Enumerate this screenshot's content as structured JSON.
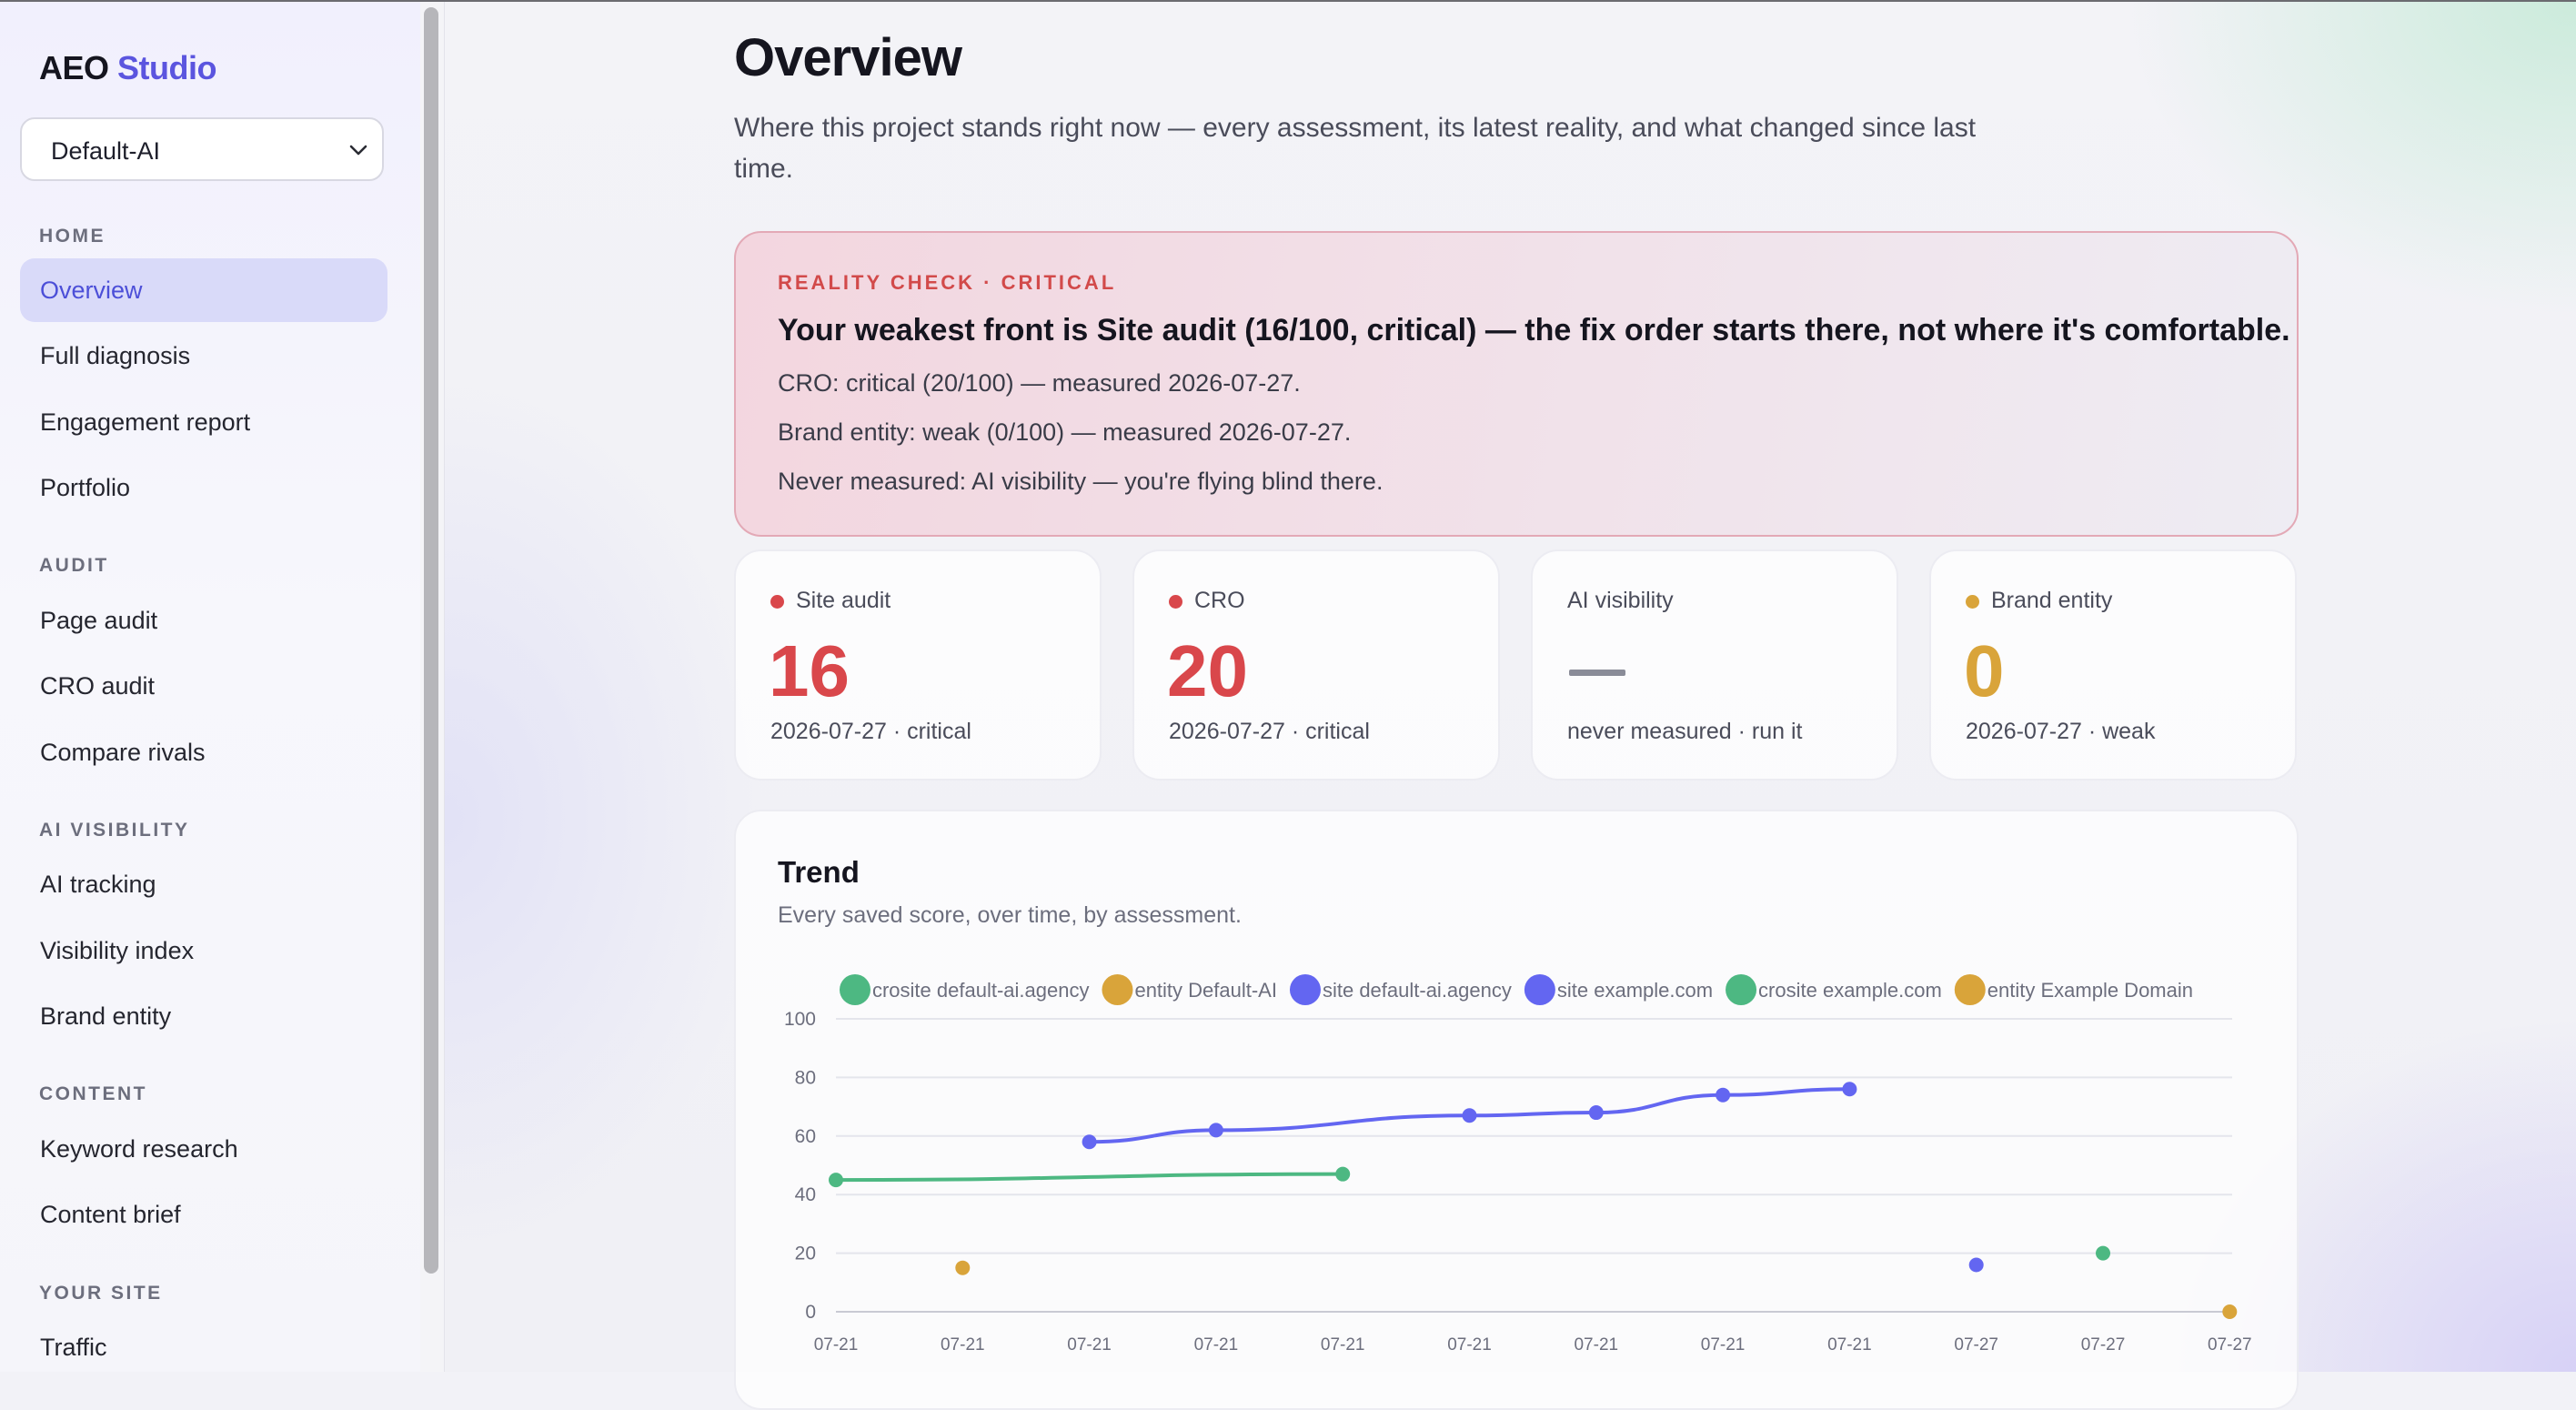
{
  "sidebar": {
    "brand": "AEO",
    "brand_accent": "Studio",
    "project_select": {
      "value": "Default-AI"
    },
    "sections": [
      {
        "title": "HOME",
        "items": [
          {
            "label": "Overview",
            "active": true
          },
          {
            "label": "Full diagnosis"
          },
          {
            "label": "Engagement report"
          },
          {
            "label": "Portfolio"
          }
        ]
      },
      {
        "title": "AUDIT",
        "items": [
          {
            "label": "Page audit"
          },
          {
            "label": "CRO audit"
          },
          {
            "label": "Compare rivals"
          }
        ]
      },
      {
        "title": "AI VISIBILITY",
        "items": [
          {
            "label": "AI tracking"
          },
          {
            "label": "Visibility index"
          },
          {
            "label": "Brand entity"
          }
        ]
      },
      {
        "title": "CONTENT",
        "items": [
          {
            "label": "Keyword research"
          },
          {
            "label": "Content brief"
          }
        ]
      },
      {
        "title": "YOUR SITE",
        "items": [
          {
            "label": "Traffic"
          }
        ]
      }
    ]
  },
  "main": {
    "title": "Overview",
    "subtitle": "Where this project stands right now — every assessment, its latest reality, and what changed since last time.",
    "reality_check": {
      "eyebrow": "REALITY CHECK · CRITICAL",
      "headline": "Your weakest front is Site audit (16/100, critical) — the fix order starts there, not where it's comfortable.",
      "lines": [
        "CRO: critical (20/100) — measured 2026-07-27.",
        "Brand entity: weak (0/100) — measured 2026-07-27.",
        "Never measured: AI visibility — you're flying blind there."
      ]
    },
    "scores": [
      {
        "name": "Site audit",
        "score": "16",
        "meta": "2026-07-27 · critical",
        "color": "#d9474b",
        "dot": true
      },
      {
        "name": "CRO",
        "score": "20",
        "meta": "2026-07-27 · critical",
        "color": "#d9474b",
        "dot": true
      },
      {
        "name": "AI visibility",
        "score": "",
        "meta": "never measured · run it",
        "color": "#8a8c98",
        "dot": false
      },
      {
        "name": "Brand entity",
        "score": "0",
        "meta": "2026-07-27 · weak",
        "color": "#d9a43a",
        "dot": true
      }
    ],
    "trend": {
      "title": "Trend",
      "subtitle": "Every saved score, over time, by assessment."
    }
  },
  "chart_data": {
    "type": "line",
    "title": "Trend",
    "subtitle": "Every saved score, over time, by assessment.",
    "x_labels": [
      "07-21",
      "07-21",
      "07-21",
      "07-21",
      "07-21",
      "07-21",
      "07-21",
      "07-21",
      "07-21",
      "07-27",
      "07-27",
      "07-27"
    ],
    "ylim": [
      0,
      100
    ],
    "yticks": [
      0,
      20,
      40,
      60,
      80,
      100
    ],
    "grid": true,
    "legend_position": "top",
    "series": [
      {
        "name": "crosite default-ai.agency",
        "color": "#4db882",
        "points": [
          [
            0,
            45
          ],
          [
            4,
            47
          ]
        ]
      },
      {
        "name": "entity Default-AI",
        "color": "#d9a43a",
        "points": [
          [
            1,
            15
          ]
        ]
      },
      {
        "name": "site default-ai.agency",
        "color": "#6366f1",
        "points": [
          [
            2,
            58
          ],
          [
            3,
            62
          ],
          [
            5,
            67
          ],
          [
            6,
            68
          ],
          [
            7,
            74
          ],
          [
            8,
            76
          ]
        ]
      },
      {
        "name": "site example.com",
        "color": "#6366f1",
        "points": [
          [
            9,
            16
          ]
        ]
      },
      {
        "name": "crosite example.com",
        "color": "#4db882",
        "points": [
          [
            10,
            20
          ]
        ]
      },
      {
        "name": "entity Example Domain",
        "color": "#d9a43a",
        "points": [
          [
            11,
            0
          ]
        ]
      }
    ]
  }
}
